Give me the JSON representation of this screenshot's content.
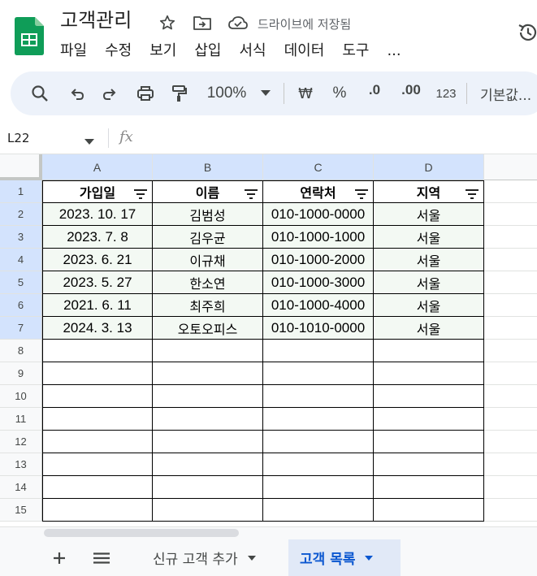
{
  "header": {
    "doc_title": "고객관리",
    "save_status": "드라이브에 저장됨",
    "menu": [
      "파일",
      "수정",
      "보기",
      "삽입",
      "서식",
      "데이터",
      "도구",
      "..."
    ]
  },
  "toolbar": {
    "zoom": "100%",
    "currency": "₩",
    "percent": "%",
    "decrease_decimal": ".0",
    "increase_decimal": ".00",
    "number_format": "123",
    "default_font": "기본값..."
  },
  "formula_bar": {
    "cell_ref": "L22",
    "fx": "fx"
  },
  "grid": {
    "columns": [
      "A",
      "B",
      "C",
      "D"
    ],
    "rows": [
      "1",
      "2",
      "3",
      "4",
      "5",
      "6",
      "7",
      "8",
      "9",
      "10",
      "11",
      "12",
      "13",
      "14",
      "15"
    ],
    "table_header": [
      "가입일",
      "이름",
      "연락처",
      "지역"
    ],
    "table_rows": [
      [
        "2023. 10. 17",
        "김범성",
        "010-1000-0000",
        "서울"
      ],
      [
        "2023. 7. 8",
        "김우균",
        "010-1000-1000",
        "서울"
      ],
      [
        "2023. 6. 21",
        "이규채",
        "010-1000-2000",
        "서울"
      ],
      [
        "2023. 5. 27",
        "한소연",
        "010-1000-3000",
        "서울"
      ],
      [
        "2021. 6. 11",
        "최주희",
        "010-1000-4000",
        "서울"
      ],
      [
        "2024. 3. 13",
        "오토오피스",
        "010-1010-0000",
        "서울"
      ]
    ]
  },
  "sheets": {
    "tabs": [
      {
        "label": "신규 고객 추가",
        "active": false
      },
      {
        "label": "고객 목록",
        "active": true
      }
    ]
  },
  "colors": {
    "accent": "#0b57d0",
    "toolbar_bg": "#edf2fa",
    "logo_green": "#0f9d58",
    "selected_header": "#d3e3fd"
  }
}
